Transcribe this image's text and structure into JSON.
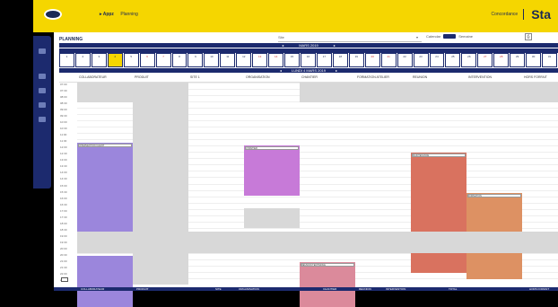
{
  "topbar": {
    "nav": [
      "▸ Appz",
      "Planning"
    ],
    "right_label": "Concordance",
    "brand": "Sta"
  },
  "main": {
    "title": "PLANNING",
    "filter_placeholder": "Site",
    "toggle_left": "Calendar",
    "toggle_right": "Semaine",
    "month_label": "MARS 2019",
    "date_label": "LUNDI 4 MARS 2019"
  },
  "days": [
    "1",
    "2",
    "3",
    "4",
    "5",
    "6",
    "7",
    "8",
    "9",
    "10",
    "11",
    "12",
    "13",
    "14",
    "15",
    "16",
    "17",
    "18",
    "19",
    "20",
    "21",
    "22",
    "23",
    "24",
    "25",
    "26",
    "27",
    "28",
    "29",
    "30",
    "31"
  ],
  "columns": [
    "COLLABORATEUR",
    "PRODUIT",
    "SITE 1",
    "ORGANISATION",
    "CHANTIER",
    "FORMATION ATELIER",
    "REUNION",
    "INTERVENTION",
    "HORS FORFAIT"
  ],
  "times": [
    "07:00",
    "07:30",
    "08:00",
    "08:30",
    "09:00",
    "09:30",
    "10:00",
    "10:30",
    "11:00",
    "11:30",
    "12:00",
    "12:30",
    "13:00",
    "13:30",
    "14:00",
    "14:30",
    "15:00",
    "15:30",
    "16:00",
    "16:30",
    "17:00",
    "17:30",
    "18:00",
    "18:30",
    "19:00",
    "19:30",
    "20:00",
    "20:30",
    "21:00",
    "21:30",
    "22:00",
    "22:30"
  ],
  "events": {
    "ev1": "INTERVENTION CLIENT",
    "ev2": "CHANTIER",
    "ev3": "REUNION TECHNIQUE",
    "ev4": "MAINTENANCE",
    "ev5": "FORMATION"
  },
  "footer": [
    "COLLABORATEUR",
    "PRODUIT",
    "SITE",
    "ORGANISATION",
    "CHANTIER",
    "REUNION",
    "INTERVENTION",
    "TOTAL",
    "HORS FORFAIT"
  ],
  "colors": {
    "accent": "#f5d600",
    "navy": "#1c2a6e",
    "purple": "#9b86dc",
    "magenta": "#c77ad8",
    "salmon": "#d9725f",
    "orange": "#dd9163",
    "pink": "#db8a9b"
  }
}
